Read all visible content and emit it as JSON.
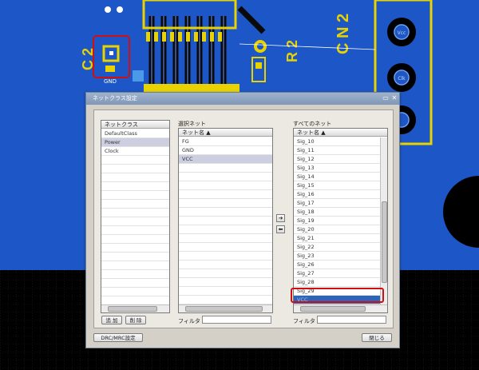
{
  "pcb": {
    "labels": {
      "cn2": "C N 2",
      "r2": "R 2",
      "c2": "C 2",
      "gnd": "GND",
      "vcc": "Vcc",
      "clk": "Clk"
    }
  },
  "dialog": {
    "title": "ネットクラス設定",
    "netclass": {
      "header": "ネットクラス",
      "items": [
        "DefaultClass",
        "Power",
        "Clock"
      ],
      "selected_index": 1,
      "add_label": "追 加",
      "delete_label": "削 除"
    },
    "selected_nets": {
      "section_label": "選択ネット",
      "header": "ネット名 ▲",
      "items": [
        "FG",
        "GND",
        "VCC"
      ],
      "selected_index": 2,
      "filter_label": "フィルタ"
    },
    "all_nets": {
      "section_label": "すべてのネット",
      "header": "ネット名 ▲",
      "items": [
        "Sig_10",
        "Sig_11",
        "Sig_12",
        "Sig_13",
        "Sig_14",
        "Sig_15",
        "Sig_16",
        "Sig_17",
        "Sig_18",
        "Sig_19",
        "Sig_20",
        "Sig_21",
        "Sig_22",
        "Sig_23",
        "Sig_26",
        "Sig_27",
        "Sig_28",
        "Sig_29",
        "VCC"
      ],
      "selected_index": 18,
      "filter_label": "フィルタ"
    },
    "move_right": "➔",
    "move_left": "⬅",
    "drc_button": "DRC/MRC設定",
    "close_button": "閉じる"
  }
}
